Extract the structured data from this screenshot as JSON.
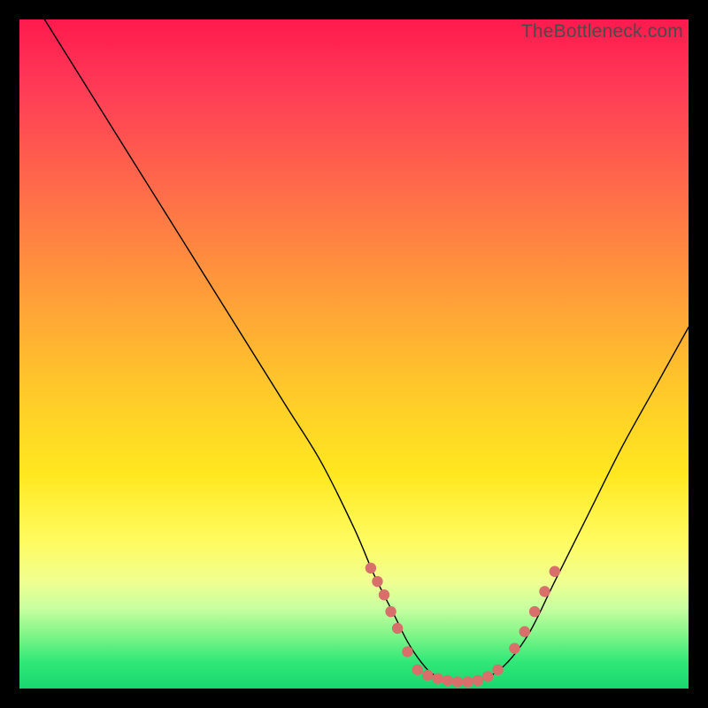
{
  "watermark": "TheBottleneck.com",
  "chart_data": {
    "type": "line",
    "title": "",
    "xlabel": "",
    "ylabel": "",
    "xlim": [
      0,
      100
    ],
    "ylim": [
      0,
      100
    ],
    "grid": false,
    "legend": false,
    "series": [
      {
        "name": "bottleneck-curve",
        "x": [
          0,
          5,
          10,
          15,
          20,
          25,
          30,
          35,
          40,
          45,
          50,
          53,
          56,
          58,
          60,
          62,
          65,
          68,
          72,
          76,
          80,
          85,
          90,
          95,
          100
        ],
        "y": [
          106,
          98,
          90,
          82,
          74,
          66,
          58,
          50,
          42,
          34,
          24,
          17,
          11,
          7,
          4,
          2,
          1,
          1,
          3,
          8,
          16,
          26,
          36,
          45,
          54
        ],
        "stroke": "#000000",
        "stroke_width": 1.4
      }
    ],
    "markers": [
      {
        "name": "left-cluster",
        "color": "#d86f6a",
        "radius": 6.2,
        "points": [
          {
            "x": 52.5,
            "y": 18.0
          },
          {
            "x": 53.5,
            "y": 16.0
          },
          {
            "x": 54.5,
            "y": 14.0
          },
          {
            "x": 55.5,
            "y": 11.5
          },
          {
            "x": 56.5,
            "y": 9.0
          },
          {
            "x": 58.0,
            "y": 5.5
          }
        ]
      },
      {
        "name": "bottom-cluster",
        "color": "#d86f6a",
        "radius": 6.2,
        "points": [
          {
            "x": 59.5,
            "y": 2.8
          },
          {
            "x": 61.0,
            "y": 2.0
          },
          {
            "x": 62.5,
            "y": 1.5
          },
          {
            "x": 64.0,
            "y": 1.2
          },
          {
            "x": 65.5,
            "y": 1.0
          },
          {
            "x": 67.0,
            "y": 1.0
          },
          {
            "x": 68.5,
            "y": 1.2
          },
          {
            "x": 70.0,
            "y": 1.8
          },
          {
            "x": 71.5,
            "y": 2.8
          }
        ]
      },
      {
        "name": "right-cluster",
        "color": "#d86f6a",
        "radius": 6.2,
        "points": [
          {
            "x": 74.0,
            "y": 6.0
          },
          {
            "x": 75.5,
            "y": 8.5
          },
          {
            "x": 77.0,
            "y": 11.5
          },
          {
            "x": 78.5,
            "y": 14.5
          },
          {
            "x": 80.0,
            "y": 17.5
          }
        ]
      }
    ]
  }
}
